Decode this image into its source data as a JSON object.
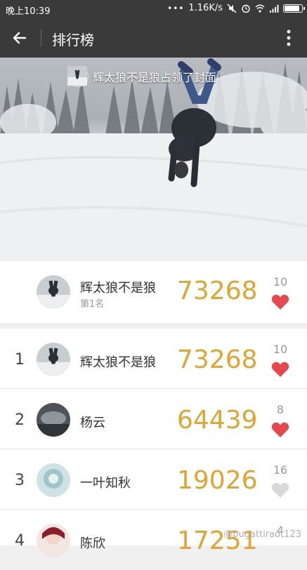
{
  "status_bar": {
    "time": "晚上10:39",
    "speed": "1.16K/s",
    "icons": [
      "mute-icon",
      "alarm-icon",
      "wifi-icon",
      "signal-icon",
      "battery-icon"
    ],
    "battery_level": 0.9
  },
  "header": {
    "title": "排行榜",
    "back_icon": "arrow-left-icon",
    "more_icon": "more-vertical-icon"
  },
  "cover": {
    "caption": "辉太狼不是狼占领了封面"
  },
  "my_rank": {
    "name": "辉太狼不是狼",
    "rank_text": "第1名",
    "score": "73268",
    "likes": "10",
    "liked": true
  },
  "ranking": [
    {
      "rank": "1",
      "name": "辉太狼不是狼",
      "score": "73268",
      "likes": "10",
      "liked": true
    },
    {
      "rank": "2",
      "name": "杨云",
      "score": "64439",
      "likes": "8",
      "liked": true
    },
    {
      "rank": "3",
      "name": "一叶知秋",
      "score": "19026",
      "likes": "16",
      "liked": false
    },
    {
      "rank": "4",
      "name": "陈欣",
      "score": "17251",
      "likes": "4",
      "liked": false
    }
  ],
  "colors": {
    "header_bg": "#3a3a3a",
    "score": "#e0a432",
    "heart_on": "#e5484d",
    "heart_off": "#d9d9d9"
  },
  "watermark": "@bugattiraot123"
}
